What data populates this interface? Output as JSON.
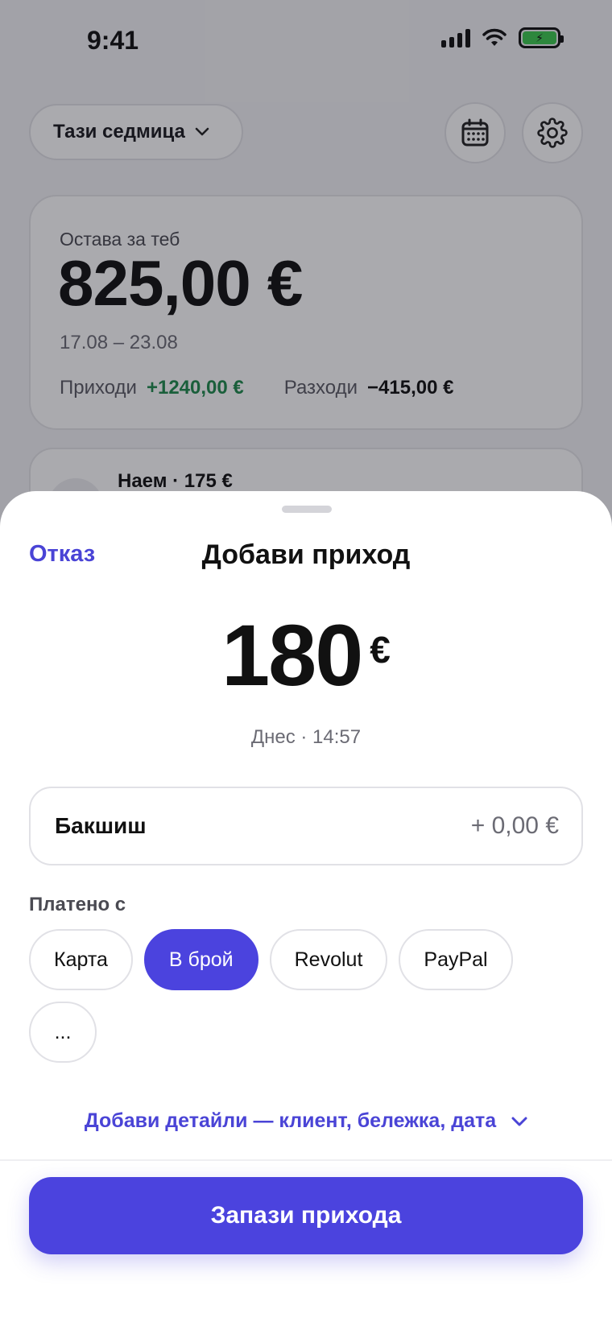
{
  "status_bar": {
    "time": "9:41"
  },
  "header": {
    "period_label": "Тази седмица"
  },
  "summary": {
    "label": "Остава за теб",
    "amount": "825,00 €",
    "date_range": "17.08 – 23.08",
    "income_label": "Приходи",
    "income_value": "+1240,00 €",
    "expense_label": "Разходи",
    "expense_value": "−415,00 €"
  },
  "rent_item": {
    "label": "Наем · 175 €"
  },
  "sheet": {
    "cancel_label": "Отказ",
    "title": "Добави приход",
    "amount": "180",
    "currency": "€",
    "date_time": "Днес · 14:57",
    "tip_label": "Бакшиш",
    "tip_value": "+ 0,00 €",
    "paid_with_label": "Платено с",
    "payment_methods": [
      "Карта",
      "В брой",
      "Revolut",
      "PayPal",
      "..."
    ],
    "selected_payment": "В брой",
    "details_link": "Добави детайли — клиент, бележка, дата",
    "save_label": "Запази прихода"
  },
  "colors": {
    "accent": "#4b43de",
    "income": "#1f8a4c",
    "battery": "#3cc84f"
  },
  "icons": [
    "chevron-down-icon",
    "calendar-icon",
    "gear-icon",
    "signal-icon",
    "wifi-icon",
    "battery-icon"
  ]
}
